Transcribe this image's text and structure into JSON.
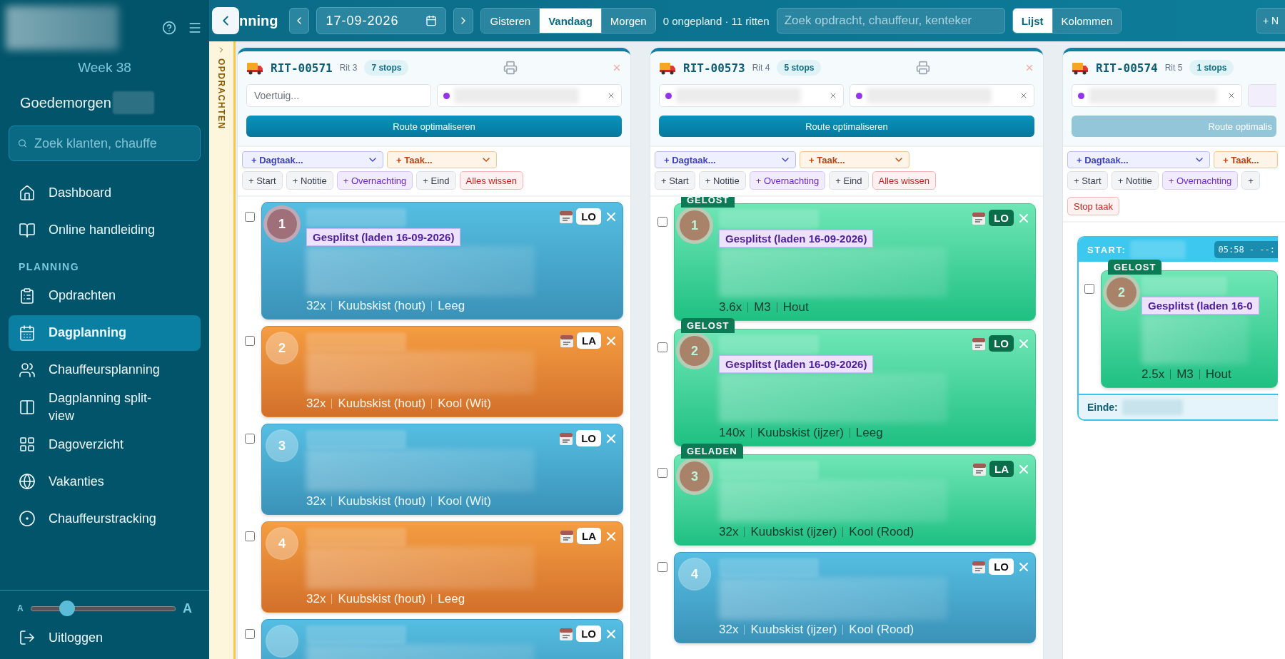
{
  "sidebar": {
    "week": "Week 38",
    "greeting": "Goedemorgen",
    "search": {
      "placeholder": "Zoek klanten, chauffe"
    },
    "nav": [
      {
        "kind": "link",
        "label": "Dashboard",
        "selected": false
      },
      {
        "kind": "link",
        "label": "Online handleiding",
        "selected": false
      },
      {
        "kind": "heading",
        "label": "PLANNING"
      },
      {
        "kind": "link",
        "label": "Opdrachten",
        "selected": false
      },
      {
        "kind": "link",
        "label": "Dagplanning",
        "selected": true
      },
      {
        "kind": "link",
        "label": "Chauffeursplanning",
        "selected": false
      },
      {
        "kind": "link",
        "label": "Dagplanning split-view",
        "selected": false
      },
      {
        "kind": "link",
        "label": "Dagoverzicht",
        "selected": false
      },
      {
        "kind": "link",
        "label": "Vakanties",
        "selected": false
      },
      {
        "kind": "link",
        "label": "Chauffeurstracking",
        "selected": false
      }
    ],
    "font_slider": {
      "small_label": "A",
      "large_label": "A",
      "level": 0.25
    },
    "logout": "Uitloggen"
  },
  "topbar": {
    "title": "nning",
    "date": "17-09-2026",
    "days": [
      {
        "label": "Gisteren",
        "selected": false
      },
      {
        "label": "Vandaag",
        "selected": true
      },
      {
        "label": "Morgen",
        "selected": false
      }
    ],
    "summary": "0 ongepland · 11 ritten",
    "search": {
      "placeholder": "Zoek opdracht, chauffeur, kenteker"
    },
    "views": [
      {
        "label": "Lijst",
        "selected": true
      },
      {
        "label": "Kolommen",
        "selected": false
      }
    ],
    "new_button": "+ N"
  },
  "side_tab": "OPDRACHTEN",
  "columns": [
    {
      "code": "RIT-00571",
      "rit": "Rit 3",
      "stops_count": "7 stops",
      "fields": [
        {
          "kind": "placeholder",
          "placeholder": "Voertuig..."
        },
        {
          "kind": "redacted",
          "clearable": true
        }
      ],
      "route": {
        "label": "Route optimaliseren",
        "disabled": false
      },
      "day_task": "+ Dagtaak...",
      "task": "+ Taak...",
      "actions": [
        {
          "label": "+ Start",
          "kind": "plain"
        },
        {
          "label": "+ Notitie",
          "kind": "plain"
        },
        {
          "label": "+ Overnachting",
          "kind": "night"
        },
        {
          "label": "+ Eind",
          "kind": "plain"
        },
        {
          "label": "Alles wissen",
          "kind": "danger"
        }
      ],
      "stops": [
        {
          "number": "1",
          "kind": "unload",
          "tag": "LO",
          "checked": false,
          "highlighted": true,
          "note": "Gesplitst (laden 16-09-2026)",
          "details": [
            "32x",
            "Kuubskist (hout)",
            "Leeg"
          ]
        },
        {
          "number": "2",
          "kind": "load",
          "tag": "LA",
          "checked": false,
          "highlighted": false,
          "details": [
            "32x",
            "Kuubskist (hout)",
            "Kool (Wit)"
          ]
        },
        {
          "number": "3",
          "kind": "unload",
          "tag": "LO",
          "checked": false,
          "highlighted": false,
          "details": [
            "32x",
            "Kuubskist (hout)",
            "Kool (Wit)"
          ]
        },
        {
          "number": "4",
          "kind": "load",
          "tag": "LA",
          "checked": false,
          "highlighted": false,
          "details": [
            "32x",
            "Kuubskist (hout)",
            "Leeg"
          ]
        },
        {
          "kind": "unload",
          "tag": "LO",
          "checked": false,
          "highlighted": false
        }
      ]
    },
    {
      "code": "RIT-00573",
      "rit": "Rit 4",
      "stops_count": "5 stops",
      "fields": [
        {
          "kind": "redacted",
          "clearable": true
        },
        {
          "kind": "redacted",
          "clearable": true
        }
      ],
      "route": {
        "label": "Route optimaliseren",
        "disabled": false
      },
      "day_task": "+ Dagtaak...",
      "task": "+ Taak...",
      "actions": [
        {
          "label": "+ Start",
          "kind": "plain"
        },
        {
          "label": "+ Notitie",
          "kind": "plain"
        },
        {
          "label": "+ Overnachting",
          "kind": "night"
        },
        {
          "label": "+ Eind",
          "kind": "plain"
        },
        {
          "label": "Alles wissen",
          "kind": "danger"
        }
      ],
      "stops": [
        {
          "number": "1",
          "kind": "done",
          "status": "GELOST",
          "tag": "LO",
          "checked": false,
          "highlighted": false,
          "note": "Gesplitst (laden 16-09-2026)",
          "details": [
            "3.6x",
            "M3",
            "Hout"
          ]
        },
        {
          "number": "2",
          "kind": "done",
          "status": "GELOST",
          "tag": "LO",
          "checked": false,
          "highlighted": false,
          "note": "Gesplitst (laden 16-09-2026)",
          "details": [
            "140x",
            "Kuubskist (ijzer)",
            "Leeg"
          ]
        },
        {
          "number": "3",
          "kind": "done",
          "status": "GELADEN",
          "tag": "LA",
          "checked": false,
          "highlighted": false,
          "details": [
            "32x",
            "Kuubskist (ijzer)",
            "Kool (Rood)"
          ]
        },
        {
          "number": "4",
          "kind": "unload",
          "tag": "LO",
          "checked": false,
          "highlighted": false,
          "details": [
            "32x",
            "Kuubskist (ijzer)",
            "Kool (Rood)"
          ]
        }
      ]
    },
    {
      "code": "RIT-00574",
      "rit": "Rit 5",
      "stops_count": "1 stops",
      "fields": [
        {
          "kind": "redacted",
          "clearable": true
        },
        {
          "kind": "redacted",
          "clearable": false
        }
      ],
      "route": {
        "label": "Route optimalis",
        "disabled": true
      },
      "day_task": "+ Dagtaak...",
      "task": "+ Taak...",
      "actions": [
        {
          "label": "+ Start",
          "kind": "plain"
        },
        {
          "label": "+ Notitie",
          "kind": "plain"
        },
        {
          "label": "+ Overnachting",
          "kind": "night"
        },
        {
          "label": "+",
          "kind": "plain"
        }
      ],
      "extra_actions": [
        {
          "label": "Stop taak",
          "kind": "danger"
        }
      ],
      "group": {
        "start_label": "START:",
        "time": "05:58 - --:",
        "end_label": "Einde:",
        "stops": [
          {
            "number": "2",
            "kind": "done",
            "status": "GELOST",
            "checked": false,
            "highlighted": false,
            "note": "Gesplitst (laden 16-0",
            "details": [
              "2.5x",
              "M3",
              "Hout"
            ]
          }
        ]
      }
    }
  ]
}
